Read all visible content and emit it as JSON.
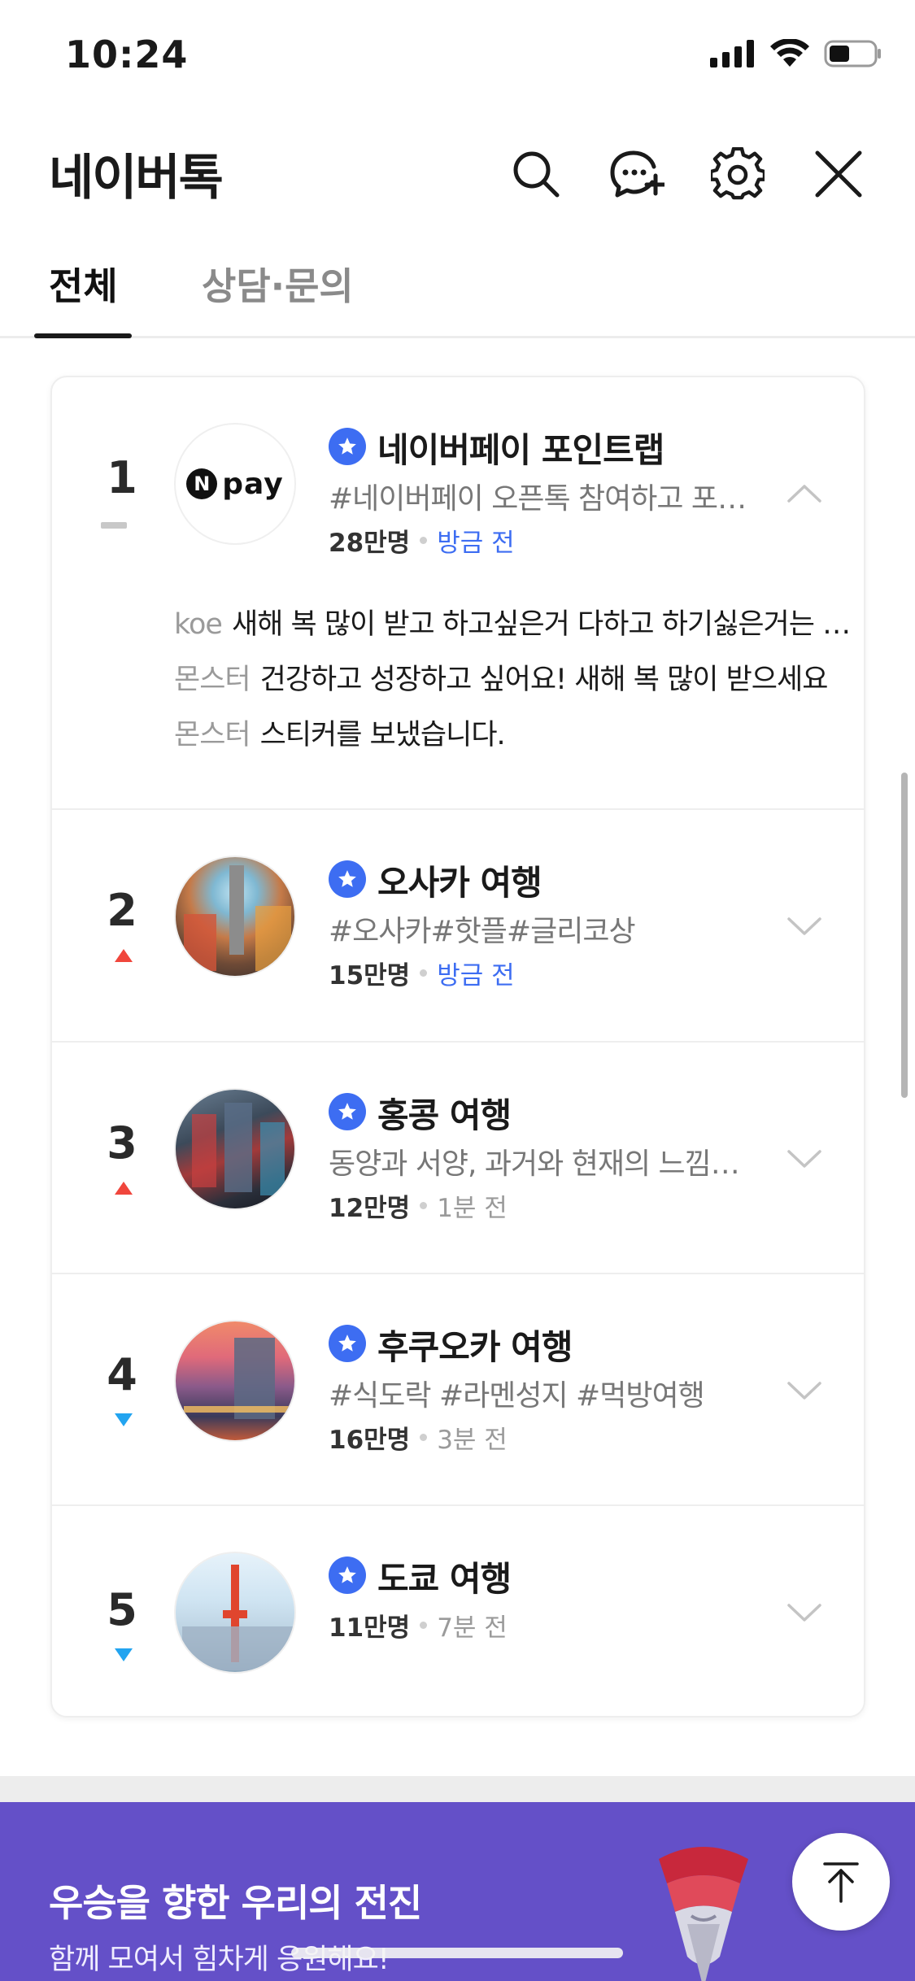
{
  "status_bar": {
    "time": "10:24"
  },
  "header": {
    "title": "네이버톡"
  },
  "tabs": [
    {
      "label": "전체",
      "active": true
    },
    {
      "label": "상담·문의",
      "active": false
    }
  ],
  "accent_color": "#3d6df2",
  "rooms": [
    {
      "rank": "1",
      "rank_change": "same",
      "avatar_text": "pay",
      "avatar_mark": "N",
      "title": "네이버페이 포인트랩",
      "description": "#네이버페이 오픈톡 참여하고 포인트 받기",
      "member_count": "28만명",
      "updated": "방금 전",
      "expanded": true,
      "messages": [
        {
          "author": "koe",
          "text": "새해 복 많이 받고 하고싶은거 다하고 하기싫은거는 안하는 한해 되세요"
        },
        {
          "author": "몬스터",
          "text": "건강하고 성장하고 싶어요! 새해 복 많이 받으세요"
        },
        {
          "author": "몬스터",
          "text": "스티커를 보냈습니다."
        }
      ]
    },
    {
      "rank": "2",
      "rank_change": "up",
      "title": "오사카 여행",
      "description": "#오사카#핫플#글리코상",
      "member_count": "15만명",
      "updated": "방금 전",
      "expanded": false
    },
    {
      "rank": "3",
      "rank_change": "up",
      "title": "홍콩 여행",
      "description": "동양과 서양, 과거와 현재의 느낌이 공존하는 곳",
      "member_count": "12만명",
      "updated": "1분 전",
      "expanded": false
    },
    {
      "rank": "4",
      "rank_change": "down",
      "title": "후쿠오카 여행",
      "description": "#식도락 #라멘성지 #먹방여행",
      "member_count": "16만명",
      "updated": "3분 전",
      "expanded": false
    },
    {
      "rank": "5",
      "rank_change": "down",
      "title": "도쿄 여행",
      "description": "",
      "member_count": "11만명",
      "updated": "7분 전",
      "expanded": false
    }
  ],
  "banner": {
    "title": "우승을 향한 우리의 전진",
    "subtitle": "함께 모여서 힘차게 응원해요!",
    "background": "#6450c8"
  }
}
